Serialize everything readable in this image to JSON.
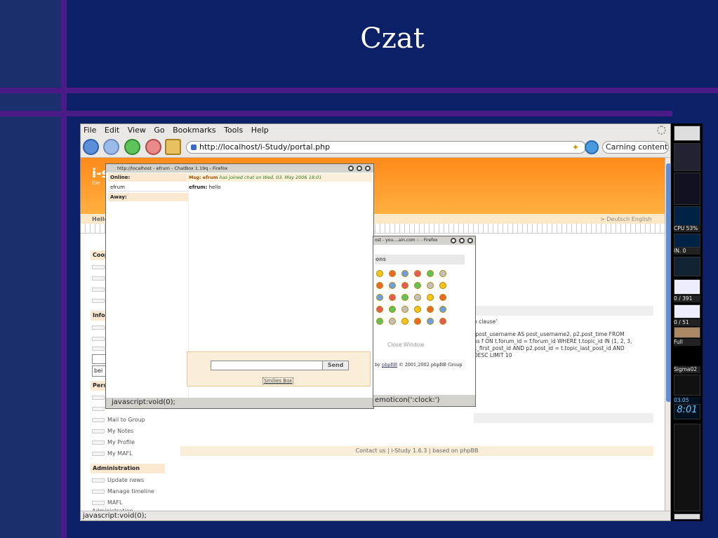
{
  "slide": {
    "title": "Czat"
  },
  "browser": {
    "menu": [
      "File",
      "Edit",
      "View",
      "Go",
      "Bookmarks",
      "Tools",
      "Help"
    ],
    "url": "http://localhost/i-Study/portal.php",
    "search_value": "Carning content",
    "status": "javascript:void(0);"
  },
  "page": {
    "logo": "i-s",
    "hello": "Hello",
    "lang": "> Deutsch  English",
    "sections": {
      "coop": "Coop",
      "info": "Infor",
      "pers": "Perso",
      "admin": "Administration"
    },
    "bei": "bei",
    "personal_items": [
      "Mail to Group",
      "My Notes",
      "My Profile",
      "My MAFL"
    ],
    "admin_items": [
      "Update news",
      "Manage timeline",
      "MAFL Administration"
    ],
    "sql_lines": [
      "n clause'",
      ".post_username AS post_username2, p2.post_time FROM",
      "ns f ON t.forum_id = f.forum_id WHERE t.topic_id IN (1, 2, 3,",
      "c_first_post_id AND p2.post_id = t.topic_last_post_id AND",
      "DESC LIMIT 10"
    ],
    "footer": "Contact us | i-Study 1.6.3 | based on phpBB"
  },
  "chat": {
    "title": "http://localhost - efrum - ChatBox 1.19q - Firefox",
    "online_label": "Online:",
    "user": "efrum",
    "away_label": "Away:",
    "msg_prefix": "Msg:",
    "msg_user": "efrum",
    "msg_text": "has joined chat on Wed, 03. May 2006 18:01",
    "line_user": "efrum:",
    "line_text": "hello",
    "send_label": "Send",
    "smilies_label": "Smilies Box",
    "status": "javascript:void(0);"
  },
  "emoticons": {
    "title": "ost - you....ain.com :: - Firefox",
    "header": "ons",
    "close_label": "Close Window",
    "by_phpbb_prefix": "by",
    "by_phpbb_link": "phpBB",
    "by_phpbb_suffix": "© 2001,2002 phpBB Group",
    "status": "emoticon(':clock:')"
  },
  "dock": {
    "cpu": "CPU 53%",
    "in": "IN.   0",
    "mail1": "0 / 391",
    "mail2": "0 / 51",
    "full": "Full",
    "sigma": "Sigma02",
    "date": "03.05",
    "clock": "8:01"
  }
}
